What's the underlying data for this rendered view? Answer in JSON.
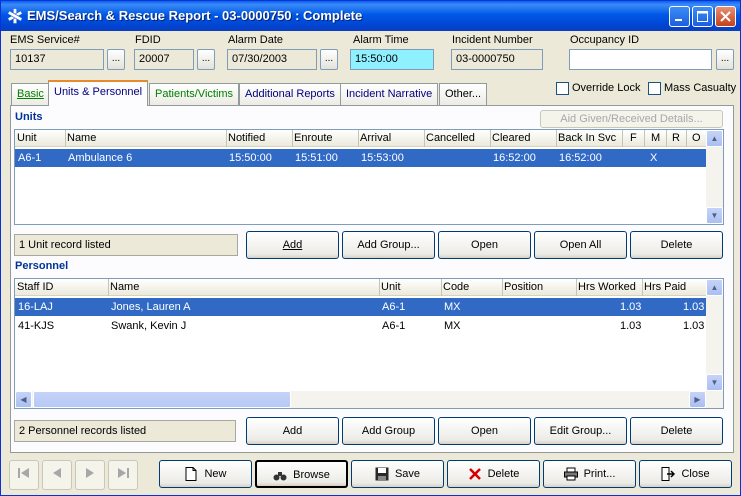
{
  "window": {
    "title": "EMS/Search & Rescue Report   - 03-0000750   : Complete",
    "icon": "asterisk-star-of-life-icon"
  },
  "header": {
    "ems_service": {
      "label": "EMS Service#",
      "value": "10137"
    },
    "fdid": {
      "label": "FDID",
      "value": "20007"
    },
    "alarm_date": {
      "label": "Alarm Date",
      "value": "07/30/2003"
    },
    "alarm_time": {
      "label": "Alarm Time",
      "value": "15:50:00"
    },
    "incident_number": {
      "label": "Incident Number",
      "value": "03-0000750"
    },
    "occupancy_id": {
      "label": "Occupancy ID",
      "value": ""
    },
    "ellipsis": "...",
    "override_lock": {
      "label": "Override Lock",
      "checked": false
    },
    "mass_casualty": {
      "label": "Mass Casualty",
      "checked": false
    }
  },
  "tabs": [
    {
      "label": "Basic",
      "active": false
    },
    {
      "label": "Units & Personnel",
      "active": true
    },
    {
      "label": "Patients/Victims",
      "active": false
    },
    {
      "label": "Additional Reports",
      "active": false
    },
    {
      "label": "Incident Narrative",
      "active": false
    },
    {
      "label": "Other...",
      "active": false
    }
  ],
  "units": {
    "title": "Units",
    "aid_button": "Aid Given/Received Details...",
    "columns": [
      "Unit",
      "Name",
      "Notified",
      "Enroute",
      "Arrival",
      "Cancelled",
      "Cleared",
      "Back In Svc",
      "F",
      "M",
      "R",
      "O"
    ],
    "rows": [
      {
        "unit": "A6-1",
        "name": "Ambulance 6",
        "notified": "15:50:00",
        "enroute": "15:51:00",
        "arrival": "15:53:00",
        "cancelled": "",
        "cleared": "16:52:00",
        "back_in_svc": "16:52:00",
        "f": "",
        "m": "X",
        "r": "",
        "o": ""
      }
    ],
    "status": "1 Unit record listed",
    "buttons": {
      "add": "Add",
      "add_group": "Add Group...",
      "open": "Open",
      "open_all": "Open All",
      "delete": "Delete"
    }
  },
  "personnel": {
    "title": "Personnel",
    "columns": [
      "Staff ID",
      "Name",
      "Unit",
      "Code",
      "Position",
      "Hrs Worked",
      "Hrs Paid"
    ],
    "rows": [
      {
        "staff_id": "16-LAJ",
        "name": "Jones, Lauren A",
        "unit": "A6-1",
        "code": "MX",
        "position": "",
        "hrs_worked": "1.03",
        "hrs_paid": "1.03"
      },
      {
        "staff_id": "41-KJS",
        "name": "Swank, Kevin J",
        "unit": "A6-1",
        "code": "MX",
        "position": "",
        "hrs_worked": "1.03",
        "hrs_paid": "1.03"
      }
    ],
    "status": "2 Personnel records listed",
    "buttons": {
      "add": "Add",
      "add_group": "Add Group",
      "open": "Open",
      "edit_group": "Edit Group...",
      "delete": "Delete"
    }
  },
  "footer": {
    "nav": [
      "first-record-icon",
      "previous-record-icon",
      "next-record-icon",
      "last-record-icon"
    ],
    "new": "New",
    "browse": "Browse",
    "save": "Save",
    "delete": "Delete",
    "print": "Print...",
    "close": "Close"
  },
  "colors": {
    "accent": "#0054e3",
    "selection": "#316ac5",
    "highlight_field": "#8ff0ff",
    "section_title": "#003399"
  }
}
